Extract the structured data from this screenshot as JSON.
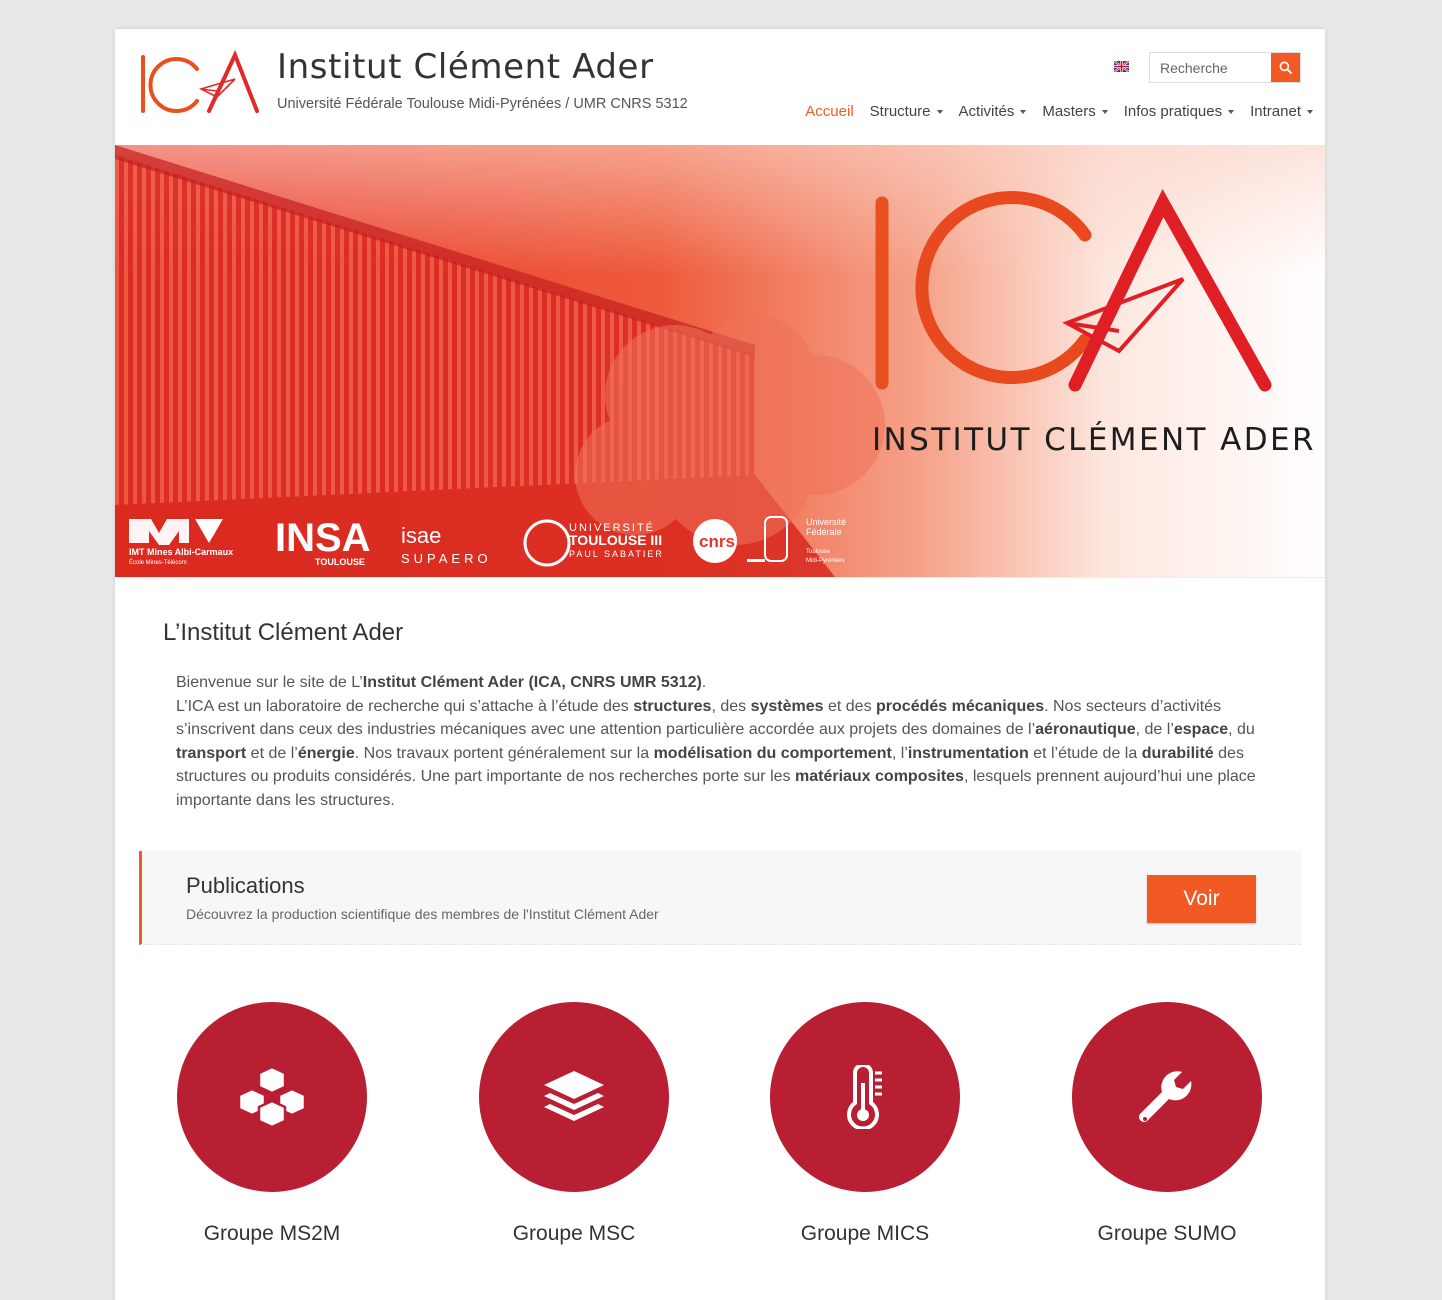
{
  "header": {
    "logo_text": "ICA",
    "site_title": "Institut Clément Ader",
    "site_description": "Université Fédérale Toulouse Midi-Pyrénées / UMR CNRS 5312",
    "language_flag": "uk-flag-icon",
    "search_placeholder": "Recherche"
  },
  "nav": [
    {
      "label": "Accueil",
      "active": true,
      "dropdown": false
    },
    {
      "label": "Structure",
      "active": false,
      "dropdown": true
    },
    {
      "label": "Activités",
      "active": false,
      "dropdown": true
    },
    {
      "label": "Masters",
      "active": false,
      "dropdown": true
    },
    {
      "label": "Infos pratiques",
      "active": false,
      "dropdown": true
    },
    {
      "label": "Intranet",
      "active": false,
      "dropdown": true
    }
  ],
  "hero": {
    "brand_title": "INSTITUT CLÉMENT ADER",
    "partners": [
      {
        "line1": "IMT Mines Albi-Carmaux",
        "line2": "École Mines-Télécom"
      },
      {
        "line1": "INSA",
        "line2": "TOULOUSE"
      },
      {
        "line1": "isae",
        "line2": "SUPAERO"
      },
      {
        "line1": "UNIVERSITÉ",
        "line2": "TOULOUSE III",
        "line3": "PAUL SABATIER"
      },
      {
        "line1": "cnrs"
      },
      {
        "line1": "Université",
        "line2": "Fédérale",
        "line3": "Toulouse",
        "line4": "Midi-Pyrénées"
      }
    ]
  },
  "intro": {
    "title": "L’Institut Clément Ader",
    "p1_pre": "Bienvenue sur le site de L’",
    "p1_bold": "Institut Clément Ader (ICA, CNRS UMR 5312)",
    "p1_post": ".",
    "s1": "L’ICA est un laboratoire de recherche qui s’attache à l’étude des ",
    "b1": "structures",
    "s2": ", des ",
    "b2": "systèmes",
    "s3": " et des ",
    "b3": "procédés mécaniques",
    "s4": ". Nos secteurs d’activités s’inscrivent dans ceux des industries mécaniques avec une attention particulière accordée aux projets des domaines de l’",
    "b4": "aéronautique",
    "s5": ", de l’",
    "b5": "espace",
    "s6": ", du ",
    "b6": "transport",
    "s7": " et de l’",
    "b7": "énergie",
    "s8": ". Nos travaux portent généralement sur la ",
    "b8": "modélisation du comportement",
    "s9": ", l’",
    "b9": "instrumentation",
    "s10": " et l’étude de la ",
    "b10": "durabilité",
    "s11": " des structures ou produits considérés. Une part importante de nos recherches porte sur les ",
    "b11": "matériaux composites",
    "s12": ", lesquels prennent aujourd’hui une place importante dans les structures."
  },
  "publications": {
    "title": "Publications",
    "description": "Découvrez la production scientifique des membres de l'Institut Clément Ader",
    "button_label": "Voir"
  },
  "groups": [
    {
      "label": "Groupe MS2M",
      "icon": "cubes-icon"
    },
    {
      "label": "Groupe MSC",
      "icon": "layers-icon"
    },
    {
      "label": "Groupe MICS",
      "icon": "thermometer-icon"
    },
    {
      "label": "Groupe SUMO",
      "icon": "wrench-icon"
    }
  ],
  "colors": {
    "accent": "#f15a24",
    "group_circle": "#b91f33",
    "hero_red": "#e8352a"
  }
}
